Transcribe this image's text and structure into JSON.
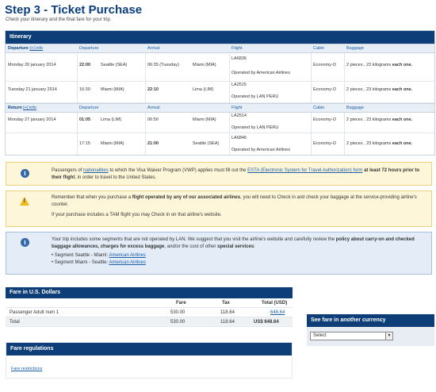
{
  "page": {
    "title": "Step 3 - Ticket Purchase",
    "subtitle": "Check your itinerary and the final fare for your trip."
  },
  "itinerary": {
    "title": "Itinerary",
    "headers": {
      "departure_label": "Departure",
      "return_label": "Return",
      "info_link": "[+] info",
      "departure": "Departure",
      "arrival": "Arrival",
      "flight": "Flight",
      "cabin": "Cabin",
      "baggage": "Baggage"
    },
    "outbound": [
      {
        "date": "Monday 20 january 2014",
        "dep_time": "22:00",
        "dep_city": "Seattle (SEA)",
        "arr_time": "06:35 (Tuesday)",
        "arr_city": "Miami (MIA)",
        "flight": "LA6836",
        "operator": "Operated by American Airlines",
        "cabin": "Economy-O",
        "bag_main": "2 pieces , 23 kilograms ",
        "bag_bold": "each one."
      },
      {
        "date": "Tuesday 21 january 2014",
        "dep_time": "16:30",
        "dep_city": "Miami (MIA)",
        "arr_time": "22:10",
        "arr_city": "Lima (LIM)",
        "flight": "LA2515",
        "operator": "Operated by LAN PERU",
        "cabin": "Economy-O",
        "bag_main": "2 pieces , 23 kilograms ",
        "bag_bold": "each one."
      }
    ],
    "return": [
      {
        "date": "Monday 27 january 2014",
        "dep_time": "01:05",
        "dep_city": "Lima (LIM)",
        "arr_time": "06:50",
        "arr_city": "Miami (MIA)",
        "flight": "LA2514",
        "operator": "Operated by LAN PERU",
        "cabin": "Economy-O",
        "bag_main": "2 pieces , 23 kilograms ",
        "bag_bold": "each one."
      },
      {
        "date": "",
        "dep_time": "17:15",
        "dep_city": "Miami (MIA)",
        "arr_time": "21:00",
        "arr_city": "Seattle (SEA)",
        "flight": "LA6846",
        "operator": "Operated by American Airlines",
        "cabin": "Economy-O",
        "bag_main": "2 pieces , 23 kilograms ",
        "bag_bold": "each one."
      }
    ]
  },
  "notices": {
    "visa": {
      "p1": "Passengers of ",
      "link1": "nationalities",
      "p2": " to which the Visa Waiver Program (VWP) applies must fill out the ",
      "link2": "ESTA (Electronic System for Travel Authorization) form",
      "bold": " at least 72 hours prior to their flight",
      "p3": ", in order to travel to the United States."
    },
    "checkin": {
      "p1": "Remember that when you purchase a ",
      "bold": "flight operated by any of our associated airlines",
      "p2": ", you will need to Check in and check your baggage at the service-providing airline's counter.",
      "p3": "If your purchase includes a TAM flight you may Check in on that airline's website."
    },
    "segments": {
      "p1": "Your trip includes some segments that are not operated by LAN. We suggest that you visit the airline’s website and carefully review the ",
      "bold1": "policy about carry-on and checked baggage allowances, charges for excess baggage",
      "p2": ", and/or the cost of other ",
      "bold2": "special services",
      "p3": ":",
      "seg1_label": "• Segment Seattle - Miami: ",
      "seg1_link": "American Airlines",
      "seg2_label": "• Segment Miami - Seattle: ",
      "seg2_link": "American Airlines"
    }
  },
  "fare": {
    "title": "Fare in U.S. Dollars",
    "col_fare": "Fare",
    "col_tax": "Tax",
    "col_total": "Total (USD)",
    "row_label": "Passenger Adult num 1",
    "row_fare": "530.00",
    "row_tax": "118.64",
    "row_total": "648.64",
    "total_label": "Total",
    "total_fare": "530.00",
    "total_tax": "118.64",
    "total_value": "US$ 648.64"
  },
  "currency": {
    "title": "See fare in another currency",
    "selected": "Select"
  },
  "regulations": {
    "title": "Fare regulations",
    "link": "Fare restrictions"
  }
}
